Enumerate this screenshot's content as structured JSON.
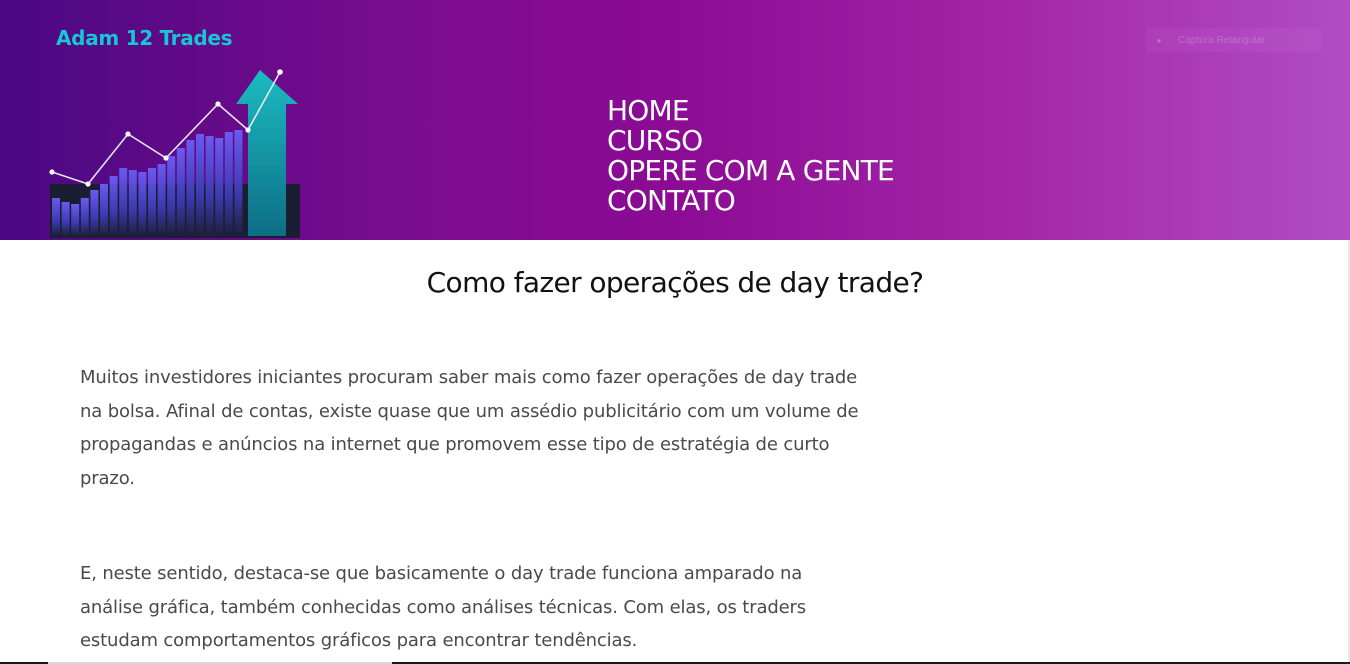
{
  "header": {
    "brand": "Adam 12 Trades",
    "capture_label": "Captura Retangular",
    "capture_icon": "dot-icon",
    "colors": {
      "gradient_start": "#4a0882",
      "gradient_mid": "#8c0b94",
      "gradient_end": "#b24cc6",
      "brand_text": "#16c6d4"
    }
  },
  "nav": {
    "items": [
      "HOME",
      "CURSO",
      "OPERE COM A GENTE",
      "CONTATO"
    ]
  },
  "article": {
    "title": "Como fazer operações de day trade?",
    "paragraphs": [
      "Muitos investidores iniciantes procuram saber mais como fazer operações de day trade na bolsa. Afinal de contas, existe quase que um assédio publicitário com um volume de propagandas e anúncios na internet que promovem esse tipo de estratégia de curto prazo.",
      "E, neste sentido, destaca-se que basicamente o day trade funciona amparado na análise gráfica, também conhecidas como análises técnicas. Com elas, os traders estudam comportamentos gráficos para encontrar tendências."
    ]
  }
}
